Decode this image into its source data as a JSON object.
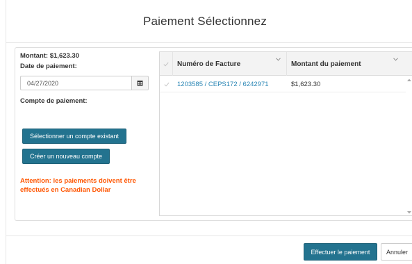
{
  "modal": {
    "title": "Paiement Sélectionnez"
  },
  "form": {
    "amount_text": "Montant: $1,623.30",
    "date_label": "Date de paiement:",
    "date_value": "04/27/2020",
    "account_label": "Compte de paiement:",
    "select_existing_label": "Sélectionner un compte existant",
    "create_new_label": "Créer un nouveau compte",
    "warning_text": "Attention: les paiements doivent être effectués en Canadian Dollar",
    "warning_color": "#ff5500"
  },
  "grid": {
    "columns": [
      "Numéro de Facture",
      "Montant du paiement"
    ],
    "rows": [
      {
        "invoice": "1203585 / CEPS172 / 6242971",
        "amount": "$1,623.30"
      }
    ]
  },
  "footer": {
    "pay_label": "Effectuer le paiement",
    "cancel_label": "Annuler"
  },
  "colors": {
    "primary": "#23738f",
    "link": "#2a86b5"
  },
  "icons": [
    "calendar-icon",
    "check-icon",
    "chevron-down-icon",
    "scroll-up-icon",
    "scroll-down-icon"
  ]
}
